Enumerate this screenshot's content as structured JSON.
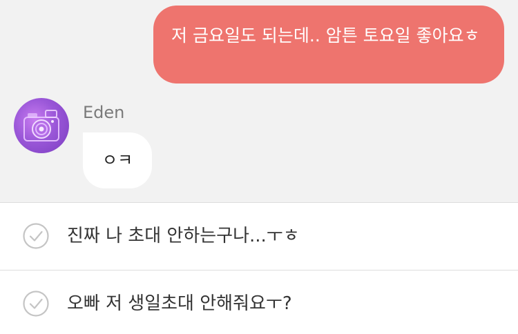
{
  "chat": {
    "outgoing_message": "저 금요일도 되는데.. 암튼 토요일 좋아요ㅎ",
    "sender": {
      "name": "Eden",
      "avatar_icon": "camera-icon"
    },
    "incoming_message": "ㅇㅋ"
  },
  "reply_options": [
    {
      "text": "진짜 나 초대 안하는구나...ㅜㅎ",
      "icon": "check-circle-icon"
    },
    {
      "text": "오빠 저 생일초대 안해줘요ㅜ?",
      "icon": "check-circle-icon"
    }
  ],
  "colors": {
    "outgoing_bubble": "#ee746e",
    "chat_background": "#f2f2f2",
    "incoming_bubble": "#ffffff",
    "avatar": "#9a57d8",
    "check_icon": "#c4c4c4"
  }
}
